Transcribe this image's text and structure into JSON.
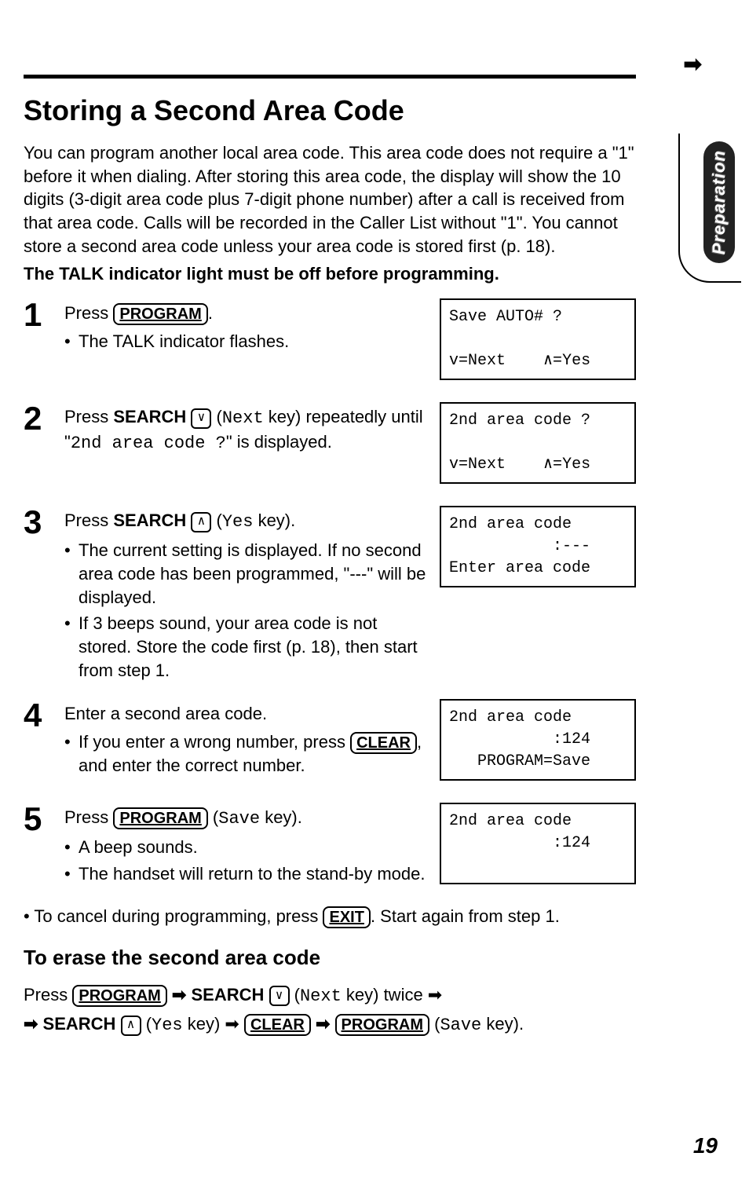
{
  "top_arrow": "➡",
  "side_tab": "Preparation",
  "title": "Storing a Second Area Code",
  "intro": "You can program another local area code. This area code does not require a \"1\" before it when dialing. After storing this area code, the display will show the 10 digits (3-digit area code plus 7-digit phone number) after a call is received from that area code. Calls will be recorded in the Caller List without \"1\". You cannot store a second area code unless your area code is stored first (p. 18).",
  "bold_note": "The TALK indicator light must be off before programming.",
  "steps": [
    {
      "num": "1",
      "line_pre": "Press ",
      "key1": "PROGRAM",
      "line_post": ".",
      "bullets": [
        "The TALK indicator flashes."
      ],
      "display": "Save AUTO# ?\n\nv=Next    ∧=Yes"
    },
    {
      "num": "2",
      "line_pre": "Press ",
      "bold_text": "SEARCH",
      "icon": "∨",
      "paren": " (Next key) repeatedly until \"",
      "mono_text": "2nd area code ?",
      "line_post": "\" is displayed.",
      "display": "2nd area code ?\n\nv=Next    ∧=Yes"
    },
    {
      "num": "3",
      "line_pre": "Press ",
      "bold_text": "SEARCH",
      "icon": "∧",
      "paren": " (Yes key).",
      "bullets": [
        "The current setting is displayed. If no second area code has been programmed, \"---\" will be displayed.",
        "If 3 beeps sound, your area code is not stored. Store the code first (p. 18), then start from step 1."
      ],
      "display": "2nd area code\n           :---\nEnter area code"
    },
    {
      "num": "4",
      "line_plain": "Enter a second area code.",
      "bullets_complex": {
        "pre": "If you enter a wrong number, press ",
        "key": "CLEAR",
        "post": ", and enter the correct number."
      },
      "display": "2nd area code\n           :124\n   PROGRAM=Save"
    },
    {
      "num": "5",
      "line_pre": "Press ",
      "key1": "PROGRAM",
      "line_post": " (Save key).",
      "bullets": [
        "A beep sounds.",
        "The handset will return to the stand-by mode."
      ],
      "display": "2nd area code\n           :124\n "
    }
  ],
  "cancel": {
    "pre": "• To cancel during programming, press ",
    "key": "EXIT",
    "post": ". Start again from step 1."
  },
  "erase_heading": "To erase the second area code",
  "erase": {
    "t1": "Press ",
    "k1": "PROGRAM",
    "arr": " ➡ ",
    "b1": "SEARCH",
    "i1": "∨",
    "t2": " (Next key) twice ➡",
    "t3": "➡ ",
    "b2": "SEARCH",
    "i2": "∧",
    "t4": " (Yes key) ➡ ",
    "k2": "CLEAR",
    "t5": " ➡ ",
    "k3": "PROGRAM",
    "t6": " (Save key)."
  },
  "page_num": "19"
}
